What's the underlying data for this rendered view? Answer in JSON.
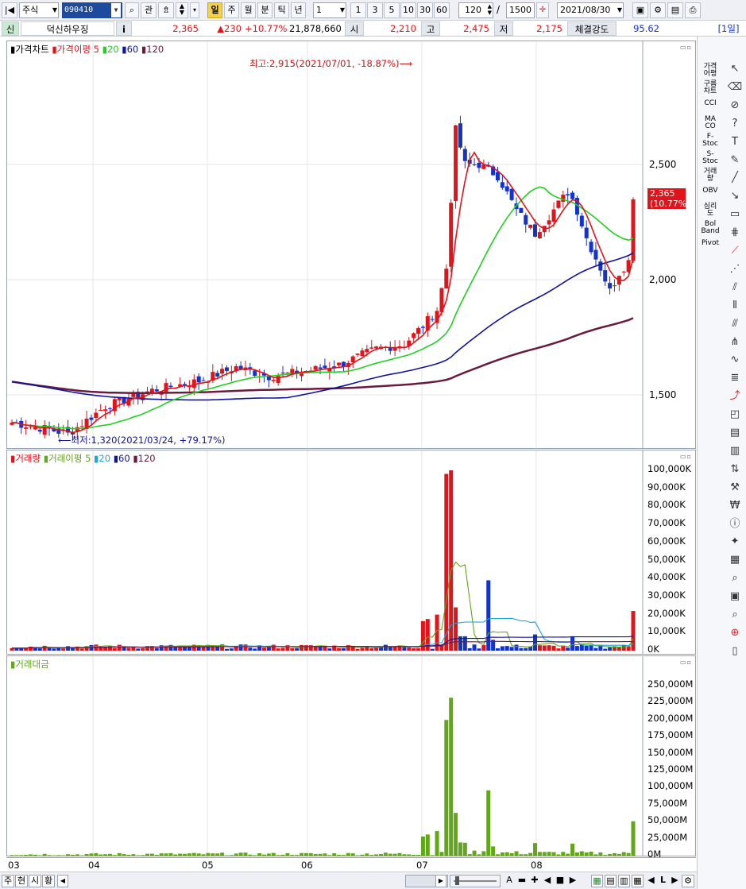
{
  "toolbar": {
    "market_type": "주식",
    "code": "090410",
    "search_label": "관",
    "period_active": "일",
    "periods": [
      "주",
      "월",
      "분",
      "틱",
      "년"
    ],
    "unit_value": "1",
    "quick_units": [
      "1",
      "3",
      "5",
      "10",
      "30",
      "60"
    ],
    "display_count": "120",
    "total_count": "1500",
    "date": "2021/08/30"
  },
  "info": {
    "badge": "신",
    "stock_name": "덕신하우징",
    "info_icon": "i",
    "price": "2,365",
    "change": "▲230",
    "change_rate": "+10.77%",
    "volume": "21,878,660",
    "open_label": "시",
    "open": "2,210",
    "high_label": "고",
    "high": "2,475",
    "low_label": "저",
    "low": "2,175",
    "strength_label": "체결강도",
    "strength": "95.62",
    "period_badge": "[1일]"
  },
  "price_pane": {
    "legend_title": "가격차트",
    "legend_ma": "가격이평 5",
    "ma20": "20",
    "ma60": "60",
    "ma120": "120",
    "y_ticks": [
      "2,500",
      "2,000",
      "1,500"
    ],
    "current_price_tag": "2,365",
    "current_rate_tag": "(10.77%)",
    "high_annotation": "최고:2,915(2021/07/01, -18.87%)⟶",
    "low_annotation": "⟵최저:1,320(2021/03/24, +79.17%)"
  },
  "volume_pane": {
    "legend_title": "거래량",
    "legend_ma": "거래이평 5",
    "ma20": "20",
    "ma60": "60",
    "ma120": "120",
    "y_ticks": [
      "100,000K",
      "90,000K",
      "80,000K",
      "70,000K",
      "60,000K",
      "50,000K",
      "40,000K",
      "30,000K",
      "20,000K",
      "10,000K",
      "0K"
    ]
  },
  "amount_pane": {
    "legend_title": "거래대금",
    "y_ticks": [
      "250,000M",
      "225,000M",
      "200,000M",
      "175,000M",
      "150,000M",
      "125,000M",
      "100,000M",
      "75,000M",
      "50,000M",
      "25,000M",
      "0M"
    ]
  },
  "x_axis": [
    "03",
    "04",
    "05",
    "06",
    "07",
    "08"
  ],
  "tools": {
    "text_items": [
      "가격\n어평",
      "구름\n차트",
      "CCI",
      "MA\nCO",
      "F-\nStoc",
      "S-\nStoc",
      "거래\n량",
      "OBV",
      "심리\n도",
      "Bol\nBand",
      "Pivot"
    ]
  },
  "bottom": {
    "tabs": [
      "주",
      "현",
      "시",
      "황"
    ]
  },
  "colors": {
    "up": "#e0151b",
    "down": "#1532c9",
    "ma5": "#e0151b",
    "ma20": "#1fd21f",
    "ma60": "#10139a",
    "ma120": "#6b1a3f",
    "amount_bar": "#62a61a"
  }
}
